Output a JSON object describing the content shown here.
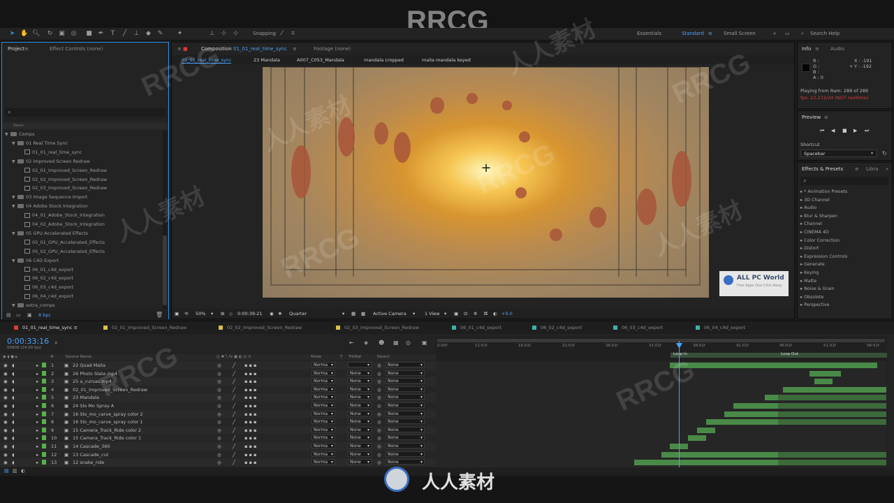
{
  "brand": {
    "watermark_top": "RRCG",
    "watermark_bottom": "人人素材",
    "bottom_logo": "人人素材",
    "badge_title": "ALL PC World",
    "badge_sub": "Free Apps One Click Away"
  },
  "toolbar": {
    "snapping": "Snapping",
    "workspaces": [
      "Essentials",
      "Standard",
      "Small Screen"
    ],
    "search_help": "Search Help"
  },
  "project_panel": {
    "tab_project": "Project",
    "tab_effect_controls": "Effect Controls (none)",
    "name_header": "Name",
    "bpc": "8 bpc",
    "tree": [
      {
        "label": "Comps",
        "type": "folder",
        "indent": 0
      },
      {
        "label": "01 Real Time Sync",
        "type": "folder",
        "indent": 1
      },
      {
        "label": "01_01_real_time_sync",
        "type": "comp",
        "indent": 2
      },
      {
        "label": "02 Improved Screen Redraw",
        "type": "folder",
        "indent": 1
      },
      {
        "label": "02_01_Improved_Screen_Redraw",
        "type": "comp",
        "indent": 2
      },
      {
        "label": "02_02_Improved_Screen_Redraw",
        "type": "comp",
        "indent": 2
      },
      {
        "label": "02_03_Improved_Screen_Redraw",
        "type": "comp",
        "indent": 2
      },
      {
        "label": "03 Image Sequence Import",
        "type": "folder",
        "indent": 1
      },
      {
        "label": "04 Adobe Stock Integration",
        "type": "folder",
        "indent": 1
      },
      {
        "label": "04_01_Adobe_Stock_Integration",
        "type": "comp",
        "indent": 2
      },
      {
        "label": "04_02_Adobe_Stock_Integration",
        "type": "comp",
        "indent": 2
      },
      {
        "label": "05 GPU Accelerated Effects",
        "type": "folder",
        "indent": 1
      },
      {
        "label": "05_01_GPU_Accelerated_Effects",
        "type": "comp",
        "indent": 2
      },
      {
        "label": "05_02_GPU_Accelerated_Effects",
        "type": "comp",
        "indent": 2
      },
      {
        "label": "06 C4D Export",
        "type": "folder",
        "indent": 1
      },
      {
        "label": "06_01_c4d_export",
        "type": "comp",
        "indent": 2
      },
      {
        "label": "06_02_c4d_export",
        "type": "comp",
        "indent": 2
      },
      {
        "label": "06_03_c4d_export",
        "type": "comp",
        "indent": 2
      },
      {
        "label": "06_04_c4d_export",
        "type": "comp",
        "indent": 2
      },
      {
        "label": "extra_comps",
        "type": "folder",
        "indent": 1
      }
    ]
  },
  "composition_panel": {
    "tab_composition": "Composition",
    "comp_name": "01_01_real_time_sync",
    "tab_footage": "Footage (none)",
    "breadcrumbs": [
      "01_01_real_time_sync",
      "23 Mandala",
      "A007_C053_Mandala",
      "mandala cropped",
      "malia mandala keyed"
    ],
    "zoom": "50%",
    "timecode": "0:00:39:21",
    "resolution": "Quarter",
    "camera": "Active Camera",
    "view": "1 View",
    "exposure": "+0.0"
  },
  "info_panel": {
    "tab_info": "Info",
    "tab_audio": "Audio",
    "channels": [
      "R :",
      "G :",
      "B :",
      "A : 0"
    ],
    "x": "X : -191",
    "y": "Y : -192",
    "playing": "Playing from Ram: 289 of 289",
    "fps": "fps: 22.272/24 (NOT realtime)"
  },
  "preview_panel": {
    "title": "Preview",
    "shortcut_label": "Shortcut",
    "shortcut_value": "Spacebar"
  },
  "effects_panel": {
    "tab_effects": "Effects & Presets",
    "tab_libraries": "Libra",
    "items": [
      "* Animation Presets",
      "3D Channel",
      "Audio",
      "Blur & Sharpen",
      "Channel",
      "CINEMA 4D",
      "Color Correction",
      "Distort",
      "Expression Controls",
      "Generate",
      "Keying",
      "Matte",
      "Noise & Grain",
      "Obsolete",
      "Perspective"
    ]
  },
  "timeline": {
    "tabs": [
      "01_01_real_time_sync",
      "02_01_Improved_Screen_Redraw",
      "02_02_Improved_Screen_Redraw",
      "02_03_Improved_Screen_Redraw",
      "06_01_c4d_export",
      "06_02_c4d_export",
      "06_03_c4d_export",
      "06_04_c4d_export"
    ],
    "tab_colors": [
      "#d63c3c",
      "#d8c24a",
      "#d8c24a",
      "#d8c24a",
      "#3fb0a8",
      "#3fb0a8",
      "#3fb0a8",
      "#3fb0a8"
    ],
    "timecode": "0:00:33:16",
    "frame_info": "00808 (24.00 fps)",
    "col_num": "#",
    "col_source": "Source Name",
    "col_mode": "Mode",
    "col_t": "T",
    "col_trkmat": "TrkMat",
    "col_parent": "Parent",
    "ruler": [
      "0:00f",
      "11:01f",
      "16:01f",
      "21:01f",
      "26:01f",
      "31:01f",
      "36:01f",
      "41:01f",
      "46:01f",
      "51:01f",
      "56:01f"
    ],
    "loop_in": "Loop In",
    "loop_out": "Loop Out",
    "layers": [
      {
        "num": "1",
        "name": "22 Quad Malia",
        "mode": "Norma",
        "trkmat": "",
        "parent": "None"
      },
      {
        "num": "2",
        "name": "26 Photo Slate.mp4",
        "mode": "Norma",
        "trkmat": "None",
        "parent": "None"
      },
      {
        "num": "3",
        "name": "25 a_curvas.mp4",
        "mode": "Norma",
        "trkmat": "None",
        "parent": "None"
      },
      {
        "num": "4",
        "name": "02_01_Improved_Screen_Redraw",
        "mode": "Norma",
        "trkmat": "None",
        "parent": "None"
      },
      {
        "num": "5",
        "name": "23 Mandala",
        "mode": "Norma",
        "trkmat": "None",
        "parent": "None"
      },
      {
        "num": "6",
        "name": "24 Slo Mo Spray A",
        "mode": "Norma",
        "trkmat": "None",
        "parent": "None"
      },
      {
        "num": "7",
        "name": "16 Slo_mo_carve_spray color 2",
        "mode": "Norma",
        "trkmat": "None",
        "parent": "None"
      },
      {
        "num": "8",
        "name": "16 Slo_mo_carve_spray color 1",
        "mode": "Norma",
        "trkmat": "None",
        "parent": "None"
      },
      {
        "num": "9",
        "name": "15 Camera_Track_Ride color 2",
        "mode": "Norma",
        "trkmat": "None",
        "parent": "None"
      },
      {
        "num": "10",
        "name": "15 Camera_Track_Ride color 1",
        "mode": "Norma",
        "trkmat": "None",
        "parent": "None"
      },
      {
        "num": "11",
        "name": "14 Cascade_360",
        "mode": "Norma",
        "trkmat": "None",
        "parent": "None"
      },
      {
        "num": "12",
        "name": "13 Cascade_cut",
        "mode": "Norma",
        "trkmat": "None",
        "parent": "None"
      },
      {
        "num": "13",
        "name": "12 snake_ride",
        "mode": "Norma",
        "trkmat": "None",
        "parent": "None"
      }
    ]
  },
  "colors": {
    "accent": "#2d8ceb",
    "layer_green": "#4a8a48",
    "label_green": "#58b04b",
    "warn_red": "#d93a3a"
  }
}
